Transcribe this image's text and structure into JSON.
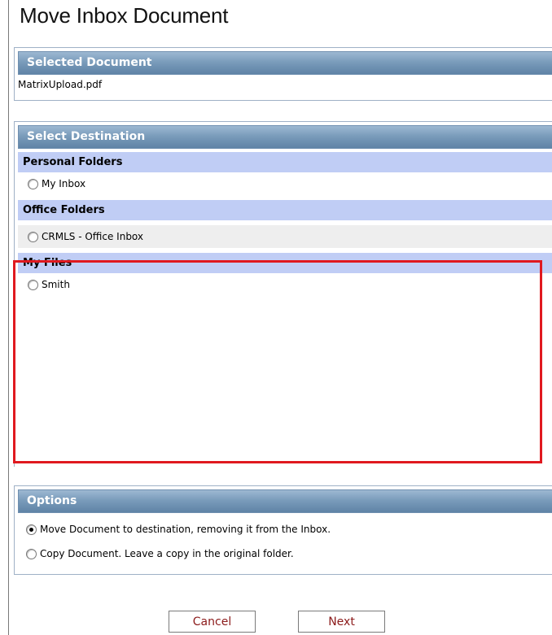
{
  "page": {
    "title": "Move Inbox Document"
  },
  "selected_document": {
    "header": "Selected Document",
    "filename": "MatrixUpload.pdf"
  },
  "destination": {
    "header": "Select Destination",
    "groups": [
      {
        "label": "Personal Folders",
        "options": [
          {
            "label": "My Inbox",
            "selected": false
          }
        ]
      },
      {
        "label": "Office Folders",
        "options": [
          {
            "label": "CRMLS - Office Inbox",
            "selected": false
          }
        ]
      },
      {
        "label": "My Files",
        "options": [
          {
            "label": "Smith",
            "selected": false
          }
        ]
      }
    ]
  },
  "options": {
    "header": "Options",
    "items": [
      {
        "label": "Move Document to destination, removing it from the Inbox.",
        "selected": true
      },
      {
        "label": "Copy Document. Leave a copy in the original folder.",
        "selected": false
      }
    ]
  },
  "buttons": {
    "cancel": "Cancel",
    "next": "Next"
  },
  "colors": {
    "highlight_box": "#e0191f",
    "group_header_bg": "#c0cdf5",
    "button_text": "#8b1a1a"
  }
}
